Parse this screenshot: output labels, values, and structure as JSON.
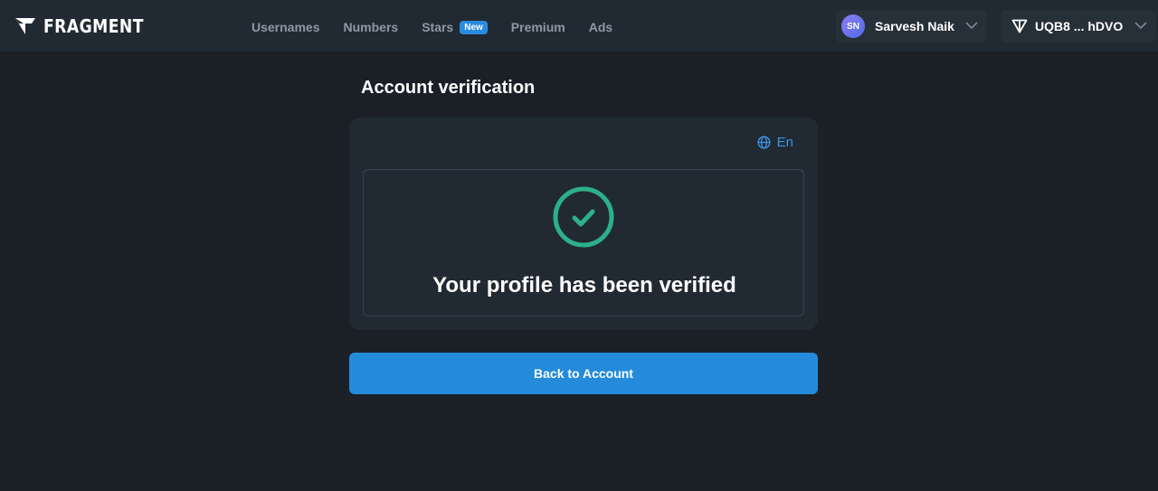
{
  "header": {
    "brand": "FRAGMENT",
    "nav": [
      {
        "label": "Usernames"
      },
      {
        "label": "Numbers"
      },
      {
        "label": "Stars",
        "badge": "New"
      },
      {
        "label": "Premium"
      },
      {
        "label": "Ads"
      }
    ],
    "user": {
      "initials": "SN",
      "name": "Sarvesh Naik"
    },
    "wallet": {
      "address": "UQB8 ... hDVO",
      "icon": "ton-icon"
    }
  },
  "page": {
    "title": "Account verification"
  },
  "card": {
    "language": "En",
    "status_text": "Your profile has been verified",
    "status_icon": "check-circle-icon",
    "status_color": "#2db08a"
  },
  "actions": {
    "back_label": "Back to Account",
    "accent_color": "#248bda"
  }
}
